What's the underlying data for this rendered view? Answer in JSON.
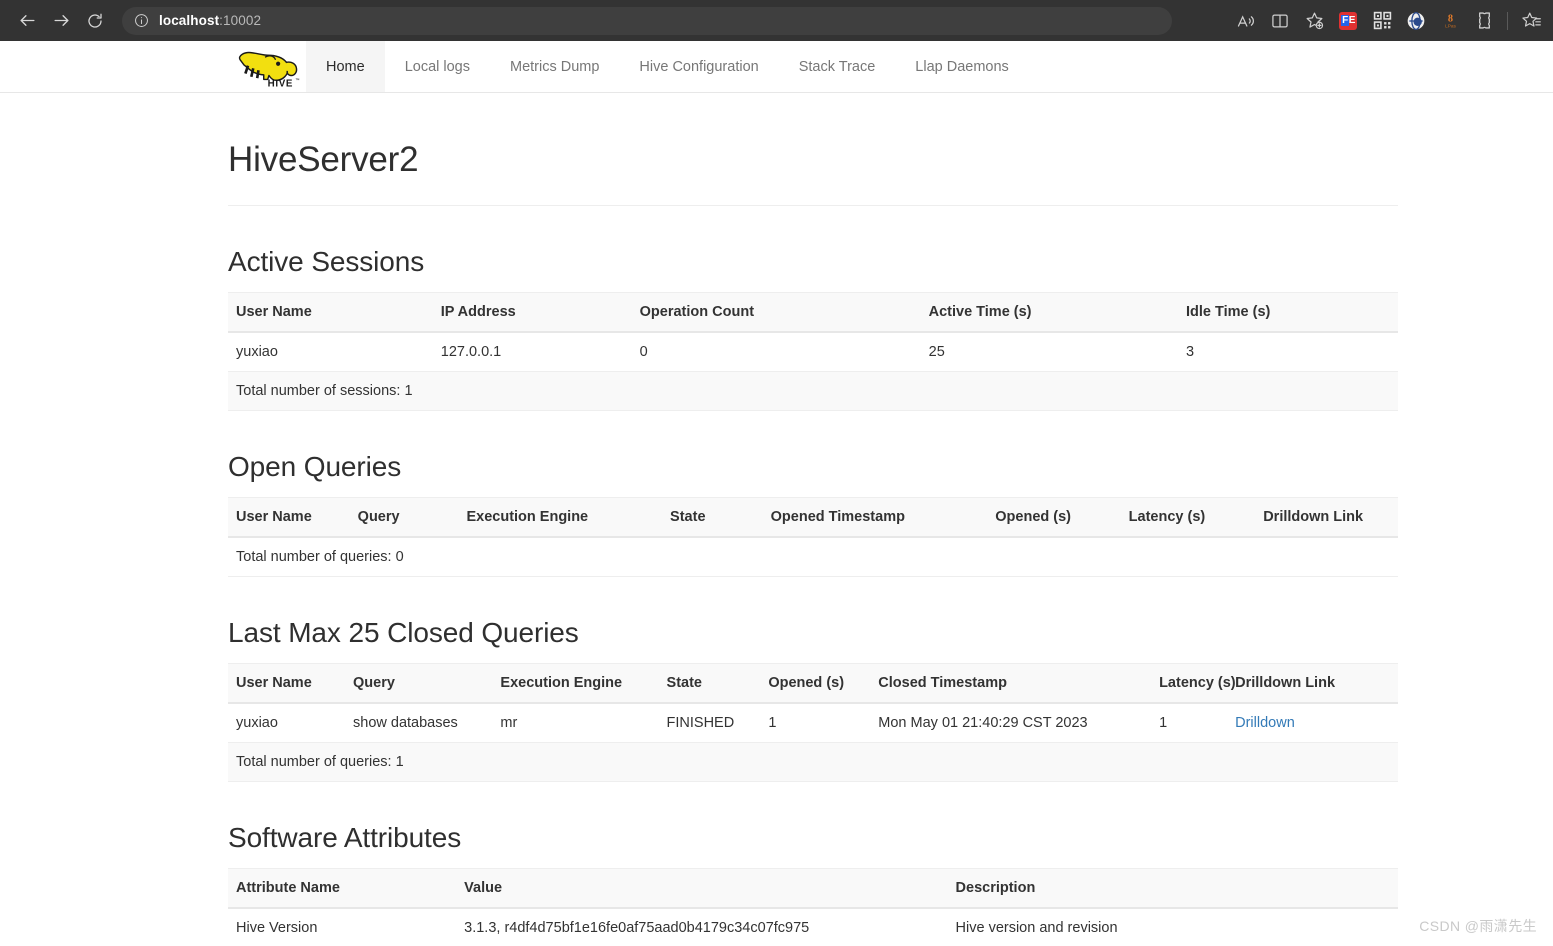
{
  "browser": {
    "back_icon": "back-arrow-icon",
    "forward_icon": "forward-arrow-icon",
    "reload_icon": "reload-icon",
    "info_icon": "site-info-icon",
    "url_host": "localhost",
    "url_port": ":10002",
    "url_full": "localhost:10002",
    "toolbar_icons": [
      {
        "name": "read-aloud-icon",
        "glyph": "A"
      },
      {
        "name": "split-screen-icon",
        "glyph": ""
      },
      {
        "name": "add-favorite-icon",
        "glyph": ""
      },
      {
        "name": "extension-fe-icon",
        "glyph": "FE",
        "color": "#e03131"
      },
      {
        "name": "qr-code-extension-icon",
        "glyph": ""
      },
      {
        "name": "translate-extension-icon",
        "glyph": ""
      },
      {
        "name": "lastpass-extension-icon",
        "glyph": ""
      },
      {
        "name": "browser-essentials-icon",
        "glyph": ""
      },
      {
        "name": "favorites-list-icon",
        "glyph": ""
      }
    ]
  },
  "hive_nav": {
    "logo_name": "hive-logo",
    "logo_text": "HIVE",
    "logo_tm": "TM",
    "items": [
      {
        "label": "Home",
        "active": true
      },
      {
        "label": "Local logs",
        "active": false
      },
      {
        "label": "Metrics Dump",
        "active": false
      },
      {
        "label": "Hive Configuration",
        "active": false
      },
      {
        "label": "Stack Trace",
        "active": false
      },
      {
        "label": "Llap Daemons",
        "active": false
      }
    ]
  },
  "page": {
    "title": "HiveServer2"
  },
  "active_sessions": {
    "title": "Active Sessions",
    "columns": [
      "User Name",
      "IP Address",
      "Operation Count",
      "Active Time (s)",
      "Idle Time (s)"
    ],
    "rows": [
      [
        "yuxiao",
        "127.0.0.1",
        "0",
        "25",
        "3"
      ]
    ],
    "footer": "Total number of sessions: 1"
  },
  "open_queries": {
    "title": "Open Queries",
    "columns": [
      "User Name",
      "Query",
      "Execution Engine",
      "State",
      "Opened Timestamp",
      "Opened (s)",
      "Latency (s)",
      "Drilldown Link"
    ],
    "rows": [],
    "footer": "Total number of queries: 0"
  },
  "closed_queries": {
    "title": "Last Max 25 Closed Queries",
    "columns": [
      "User Name",
      "Query",
      "Execution Engine",
      "State",
      "Opened (s)",
      "Closed Timestamp",
      "Latency (s)",
      "Drilldown Link"
    ],
    "rows": [
      {
        "user_name": "yuxiao",
        "query": "show databases",
        "execution_engine": "mr",
        "state": "FINISHED",
        "opened_s": "1",
        "closed_timestamp": "Mon May 01 21:40:29 CST 2023",
        "latency_s": "1",
        "drilldown_label": "Drilldown"
      }
    ],
    "footer": "Total number of queries: 1"
  },
  "software_attributes": {
    "title": "Software Attributes",
    "columns": [
      "Attribute Name",
      "Value",
      "Description"
    ],
    "rows": [
      [
        "Hive Version",
        "3.1.3, r4df4d75bf1e16fe0af75aad0b4179c34c07fc975",
        "Hive version and revision"
      ]
    ]
  },
  "watermark": {
    "text": "CSDN @雨潇先生"
  },
  "colors": {
    "link": "#337ab7",
    "chrome_bg": "#333333",
    "address_bg": "#3f3f3f",
    "table_header_bg": "#f9f9f9",
    "hive_yellow": "#f7e018"
  }
}
